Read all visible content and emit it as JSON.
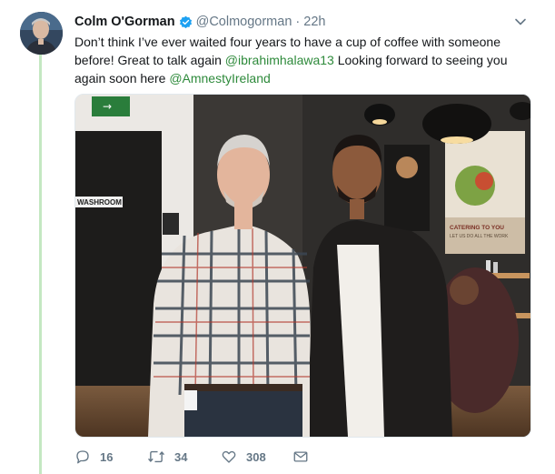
{
  "tweet": {
    "author_name": "Colm O'Gorman",
    "handle": "@Colmogorman",
    "separator": "·",
    "time": "22h",
    "text_1": "Don’t think I’ve ever waited four years to have a cup of coffee with someone before! Great to talk again ",
    "mention_1": "@ibrahimhalawa13",
    "text_2": " Looking forward to seeing you again soon here ",
    "mention_2": "@AmnestyIreland",
    "photo_signs": {
      "exit": "→",
      "washroom": "WASHROOM",
      "catering": "CATERING TO YOU",
      "catering_sub": "LET US DO ALL THE WORK"
    }
  },
  "actions": {
    "reply_count": "16",
    "retweet_count": "34",
    "like_count": "308"
  },
  "colors": {
    "accent": "#2e8a3b",
    "thread_line": "#c4e8c2",
    "muted": "#657786"
  }
}
